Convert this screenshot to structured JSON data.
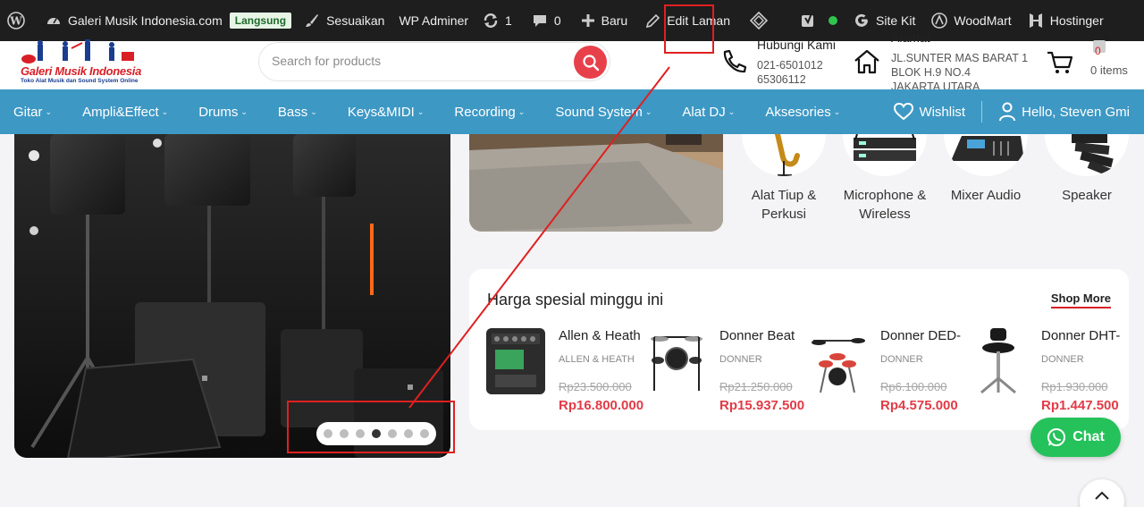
{
  "adminbar": {
    "site_name": "Galeri Musik Indonesia.com",
    "live_badge": "Langsung",
    "customize": "Sesuaikan",
    "wp_adminer": "WP Adminer",
    "updates_count": "1",
    "comments_count": "0",
    "new": "Baru",
    "edit_page": "Edit Laman",
    "site_kit": "Site Kit",
    "woodmart": "WoodMart",
    "hostinger": "Hostinger"
  },
  "header": {
    "logo_text": "Galeri Musik Indonesia",
    "logo_sub": "Toko Alat Musik dan Sound System Online",
    "search_placeholder": "Search for products",
    "contact_title": "Hubungi Kami",
    "contact_lines": [
      "021-6501012",
      "65306112"
    ],
    "address_title": "Alamat",
    "address_lines": [
      "JL.SUNTER MAS BARAT 1",
      "BLOK H.9 NO.4",
      "JAKARTA UTARA"
    ],
    "cart_count": "0",
    "cart_items": "0 items"
  },
  "nav": {
    "items": [
      "Gitar",
      "Ampli&Effect",
      "Drums",
      "Bass",
      "Keys&MIDI",
      "Recording",
      "Sound System",
      "Alat DJ",
      "Aksesories"
    ],
    "wishlist": "Wishlist",
    "user": "Hello, Steven Gmi"
  },
  "categories": [
    {
      "label": "Alat Tiup & Perkusi"
    },
    {
      "label": "Microphone & Wireless"
    },
    {
      "label": "Mixer Audio"
    },
    {
      "label": "Speaker"
    }
  ],
  "slider": {
    "dot_count": 7,
    "active_index": 3
  },
  "deals": {
    "title": "Harga spesial minggu ini",
    "shop_more": "Shop More",
    "products": [
      {
        "name": "Allen & Heath",
        "brand": "ALLEN & HEATH",
        "old_price": "Rp23.500.000",
        "price": "Rp16.800.000"
      },
      {
        "name": "Donner Beat",
        "brand": "DONNER",
        "old_price": "Rp21.250.000",
        "price": "Rp15.937.500"
      },
      {
        "name": "Donner DED-",
        "brand": "DONNER",
        "old_price": "Rp6.100.000",
        "price": "Rp4.575.000"
      },
      {
        "name": "Donner DHT-",
        "brand": "DONNER",
        "old_price": "Rp1.930.000",
        "price": "Rp1.447.500"
      }
    ]
  },
  "chat": {
    "label": "Chat"
  },
  "colors": {
    "accent_blue": "#3d98c4",
    "accent_red": "#e8404a",
    "chat_green": "#25c25b",
    "annotation_red": "#e02020"
  }
}
